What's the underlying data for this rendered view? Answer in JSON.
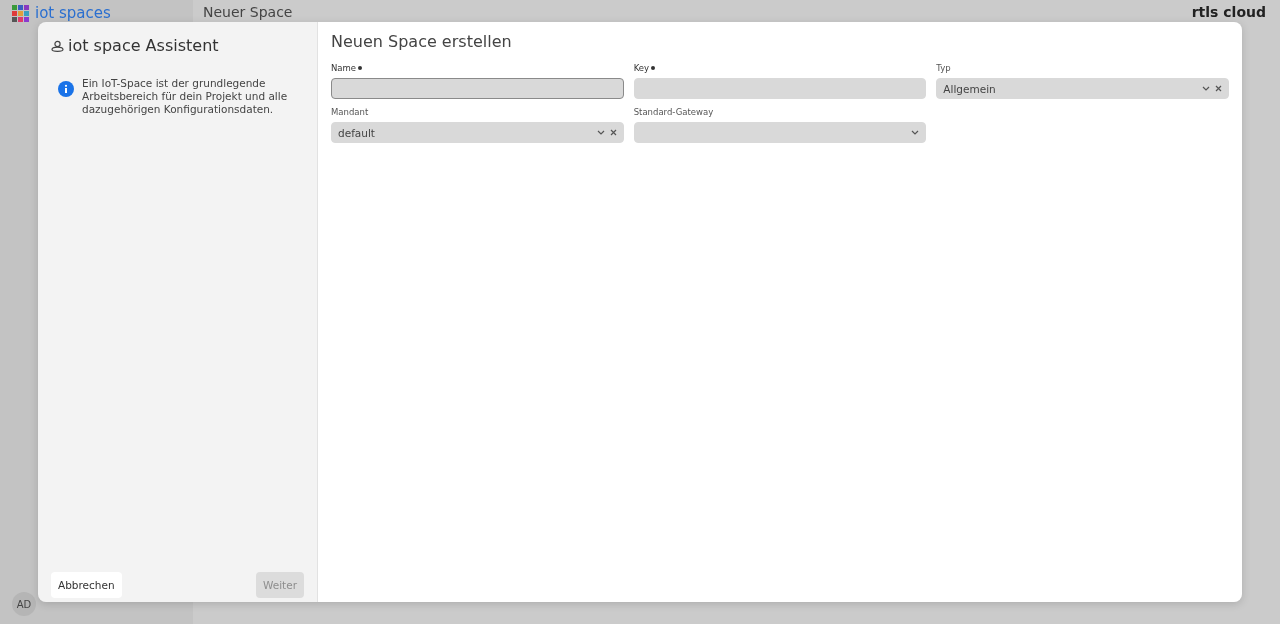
{
  "background": {
    "app_title": "iot spaces",
    "page_title": "Neuer Space",
    "brand": "rtls cloud",
    "avatar": "AD"
  },
  "wizard": {
    "title": "iot space Assistent",
    "info": "Ein IoT-Space ist der grundlegende Arbeitsbereich für dein Projekt und alle dazugehörigen Konfigurationsdaten.",
    "buttons": [
      {
        "label": "Abbrechen",
        "disabled": false
      },
      {
        "label": "Weiter",
        "disabled": true
      }
    ]
  },
  "form": {
    "title": "Neuen Space erstellen",
    "fields": [
      {
        "kind": "text",
        "label": "Name",
        "required": true,
        "focused": true
      },
      {
        "kind": "text",
        "label": "Key",
        "required": true,
        "focused": false
      },
      {
        "kind": "select",
        "label": "Typ",
        "required": false,
        "value": "Allgemein",
        "clearable": true
      },
      {
        "kind": "select",
        "label": "Mandant",
        "required": false,
        "value": "default",
        "clearable": true
      },
      {
        "kind": "select",
        "label": "Standard-Gateway",
        "required": false,
        "clearable": false
      }
    ]
  }
}
